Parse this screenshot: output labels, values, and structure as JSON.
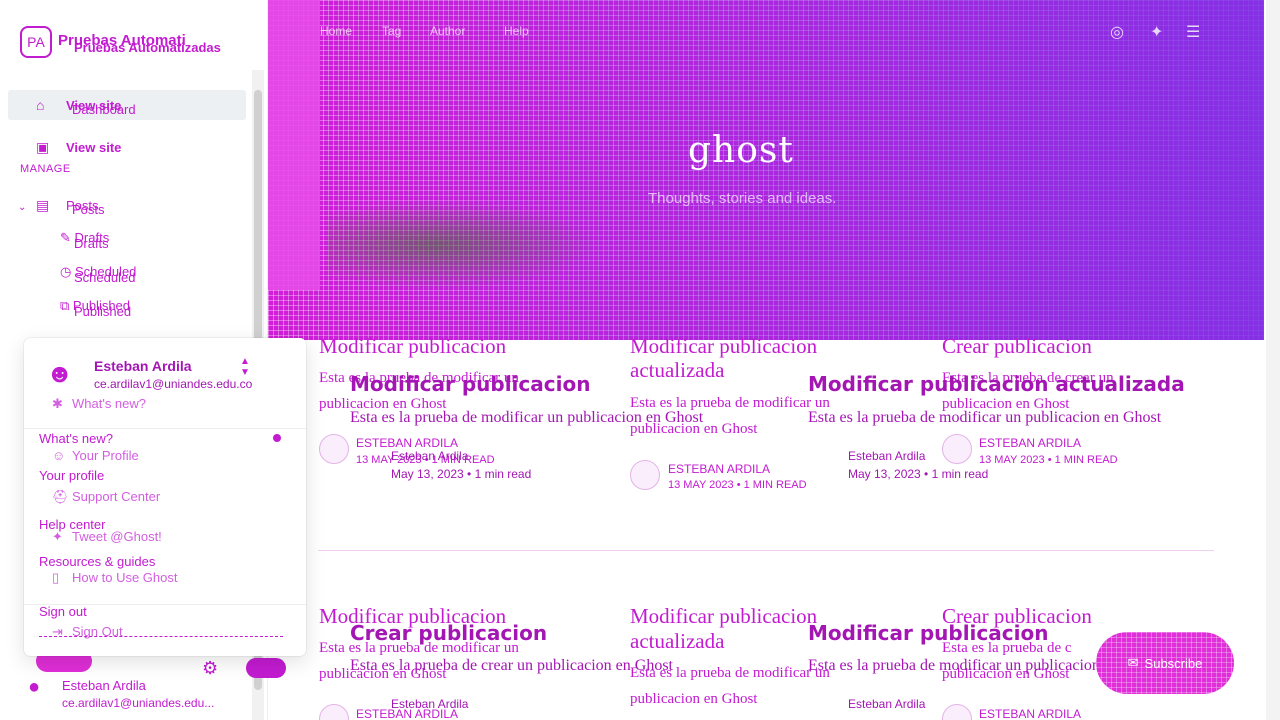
{
  "brand": {
    "name": "Pruebas Automati",
    "name_full": "Pruebas Automatizadas"
  },
  "sidebar": {
    "view_site_overlay": "View site",
    "dashboard": "Dashboard",
    "view_site": "View site",
    "manage_heading": "MANAGE",
    "posts": "Posts",
    "posts_dup": "Posts",
    "drafts": "Drafts",
    "drafts_dup": "Drafts",
    "scheduled": "Scheduled",
    "scheduled_dup": "Scheduled",
    "published": "Published",
    "published_dup": "Published",
    "footer_name": "Esteban Ardila",
    "footer_email": "ce.ardilav1@uniandes.edu..."
  },
  "menu": {
    "name": "Esteban Ardila",
    "email": "ce.ardilav1@uniandes.edu.co",
    "whats_new_sub": "What's new?",
    "whats_new": "What's new?",
    "your_profile_sub": "Your Profile",
    "your_profile": "Your profile",
    "support_center": "Support Center",
    "help_center": "Help center",
    "tweet": "Tweet @Ghost!",
    "resources": "Resources & guides",
    "how_to": "How to Use Ghost",
    "sign_out": "Sign out",
    "sign_out_sub": "Sign Out"
  },
  "site": {
    "nav": [
      "Home",
      "Tag",
      "Author",
      "Help"
    ],
    "logo": "ghost",
    "description": "Thoughts, stories and ideas.",
    "subscribe": "Subscribe"
  },
  "posts": [
    {
      "title": "Modificar publicacion",
      "excerpt_1": "Esta es la prueba de modificar un",
      "excerpt_2": "publicacion en Ghost",
      "author": "ESTEBAN ARDILA",
      "meta": "13 MAY 2023 • 1 MIN READ"
    },
    {
      "title_1": "Modificar publicacion",
      "title_2": "actualizada",
      "excerpt_1": "Esta es la prueba de modificar un",
      "excerpt_2": "publicacion en Ghost",
      "author": "ESTEBAN ARDILA",
      "meta": "13 MAY 2023 • 1 MIN READ"
    },
    {
      "title": "Crear publicacion",
      "excerpt_1": "Esta es la prueba de crear un",
      "excerpt_2": "publicacion en Ghost",
      "author": "ESTEBAN ARDILA",
      "meta": "13 MAY 2023 • 1 MIN READ"
    }
  ],
  "overlay_posts": [
    {
      "title": "Modificar publicacion",
      "excerpt": "Esta es la prueba de modificar un publicacion en Ghost",
      "author": "Esteban Ardila",
      "meta": "May 13, 2023 • 1 min read"
    },
    {
      "title": "Modificar publicacion actualizada",
      "excerpt": "Esta es la prueba de modificar un publicacion en Ghost",
      "author": "Esteban Ardila",
      "meta": "May 13, 2023 • 1 min read"
    },
    {
      "title": "Crear publicacion",
      "excerpt": "Esta es la prueba de crear un publicacion en Ghost",
      "author": "Esteban Ardila"
    },
    {
      "title": "Modificar publicacion",
      "excerpt": "Esta es la prueba de modificar un publicacion en Ghost",
      "author": "Esteban Ardila"
    }
  ],
  "row2": [
    {
      "title": "Modificar publicacion",
      "excerpt_1": "Esta es la prueba de modificar un",
      "excerpt_2": "publicacion en Ghost",
      "author": "ESTEBAN ARDILA"
    },
    {
      "title_1": "Modificar publicacion",
      "title_2": "actualizada",
      "excerpt_1": "Esta es la prueba de modificar un",
      "excerpt_2": "publicacion en Ghost"
    },
    {
      "title": "Crear publicacion",
      "excerpt_1": "Esta es la prueba de c",
      "excerpt_2": "publicacion en Ghost",
      "author": "ESTEBAN ARDILA"
    }
  ],
  "colors": {
    "accent": "#c21bd0",
    "hero": "#d21ed8",
    "hero_end": "#7a32e6"
  }
}
